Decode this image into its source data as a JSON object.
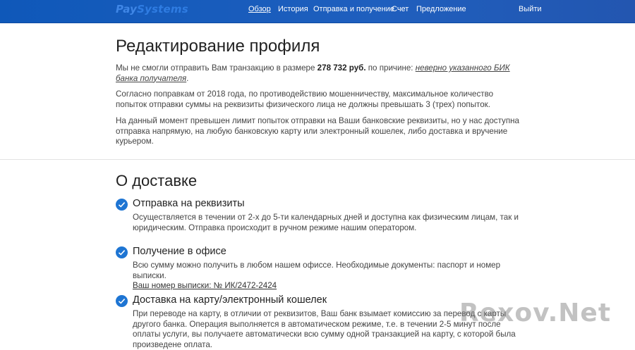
{
  "header": {
    "logo_part1": "Pay",
    "logo_part2": "Systems",
    "nav": [
      "Обзор",
      "История",
      "Отправка и получение",
      "Счет",
      "Предложение"
    ],
    "logout": "Выйти"
  },
  "profile": {
    "title": "Редактирование профиля",
    "p1_start": "Мы не смогли отправить Вам транзакцию в размере ",
    "amount": "278 732 руб.",
    "p1_mid": " по причине: ",
    "reason": "неверно указанного БИК банка получателя",
    "p1_end": ".",
    "p2": "Согласно поправкам от 2018 года, по противодействию мошенничеству, максимальное количество попыток отправки суммы на реквизиты физического лица не должны превышать 3 (трех) попыток.",
    "p3": "На данный момент превышен лимит попыток отправки на Ваши банковские реквизиты, но у нас доступна отправка напрямую, на любую банковскую карту или электронный кошелек, либо доставка и вручение курьером."
  },
  "delivery": {
    "title": "О доставке",
    "items": [
      {
        "title": "Отправка на реквизиты",
        "text": "Осуществляется в течении от 2-х до 5-ти календарных дней и доступна как физическим лицам, так и юридическим. Отправка происходит в ручном режиме нашим оператором."
      },
      {
        "title": "Получение в офисе",
        "text": "Всю сумму можно получить в любом нашем офиссе. Необходимые документы: паспорт и номер выписки.",
        "link": "Ваш номер выписки: № ИК/2472-2424"
      },
      {
        "title": "Доставка на карту/электронный кошелек",
        "text": "При переводе на карту, в отличии от реквизитов, Ваш банк взымает комиссию за перевод с карты другого банка. Операция выполняется в автоматическом режиме, т.е. в течении 2-5 минут после оплаты услуги, вы получаете автоматически всю сумму одной транзакцией на карту, с которой была произведене оплата."
      }
    ]
  },
  "watermark": "Rexov.Net",
  "colors": {
    "header": "#1a5cbc",
    "check": "#1e75d3"
  }
}
